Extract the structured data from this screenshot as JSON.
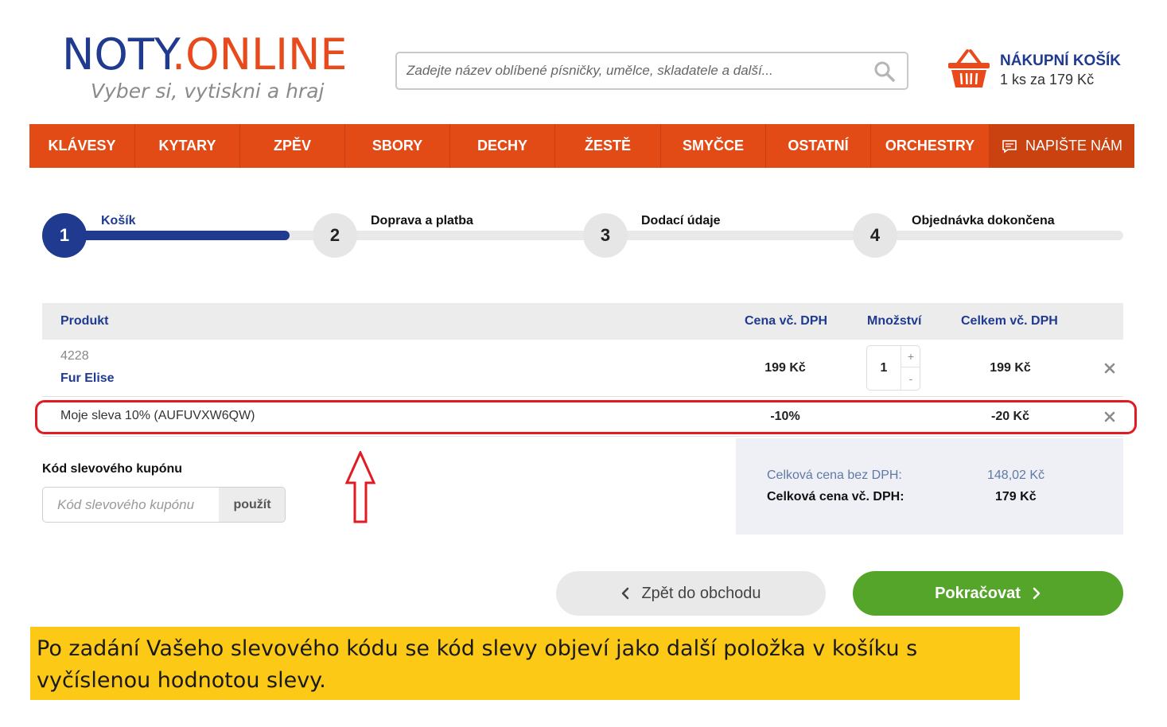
{
  "logo": {
    "part1": "NOTY",
    "part2": ".ONLINE",
    "tagline": "Vyber si, vytiskni a hraj"
  },
  "search": {
    "placeholder": "Zadejte název oblíbené písničky, umělce, skladatele a další...",
    "icon": "search-icon"
  },
  "cart": {
    "title": "NÁKUPNÍ KOŠÍK",
    "summary": "1 ks za 179 Kč",
    "icon": "basket-icon"
  },
  "nav": {
    "items": [
      "KLÁVESY",
      "KYTARY",
      "ZPĚV",
      "SBORY",
      "DECHY",
      "ŽESTĚ",
      "SMYČCE",
      "OSTATNÍ",
      "ORCHESTRY"
    ],
    "contact": "NAPIŠTE NÁM",
    "contact_icon": "message-icon"
  },
  "steps": [
    {
      "number": "1",
      "label": "Košík"
    },
    {
      "number": "2",
      "label": "Doprava a platba"
    },
    {
      "number": "3",
      "label": "Dodací údaje"
    },
    {
      "number": "4",
      "label": "Objednávka dokončena"
    }
  ],
  "table": {
    "headers": {
      "product": "Produkt",
      "price": "Cena vč. DPH",
      "quantity": "Množství",
      "total": "Celkem vč. DPH"
    },
    "item": {
      "id": "4228",
      "name": "Fur Elise",
      "price": "199 Kč",
      "quantity": "1",
      "total": "199 Kč",
      "plus": "+",
      "minus": "-"
    },
    "discount": {
      "label": "Moje sleva 10% (AUFUVXW6QW)",
      "price": "-10%",
      "total": "-20 Kč"
    }
  },
  "coupon": {
    "title": "Kód slevového kupónu",
    "placeholder": "Kód slevového kupónu",
    "button": "použít"
  },
  "summary": {
    "without_vat_label": "Celková cena bez DPH:",
    "without_vat_value": "148,02 Kč",
    "with_vat_label": "Celková cena vč. DPH:",
    "with_vat_value": "179 Kč"
  },
  "buttons": {
    "back": "Zpět do obchodu",
    "next": "Pokračovat"
  },
  "note": "Po zadání Vašeho slevového kódu se kód slevy objeví jako další položka v košíku s vyčíslenou hodnotou slevy.",
  "colors": {
    "brand_blue": "#1f3a8f",
    "brand_orange": "#e34b16",
    "green": "#55a52a",
    "highlight_red": "#e21a22",
    "note_yellow": "#fdc917"
  }
}
